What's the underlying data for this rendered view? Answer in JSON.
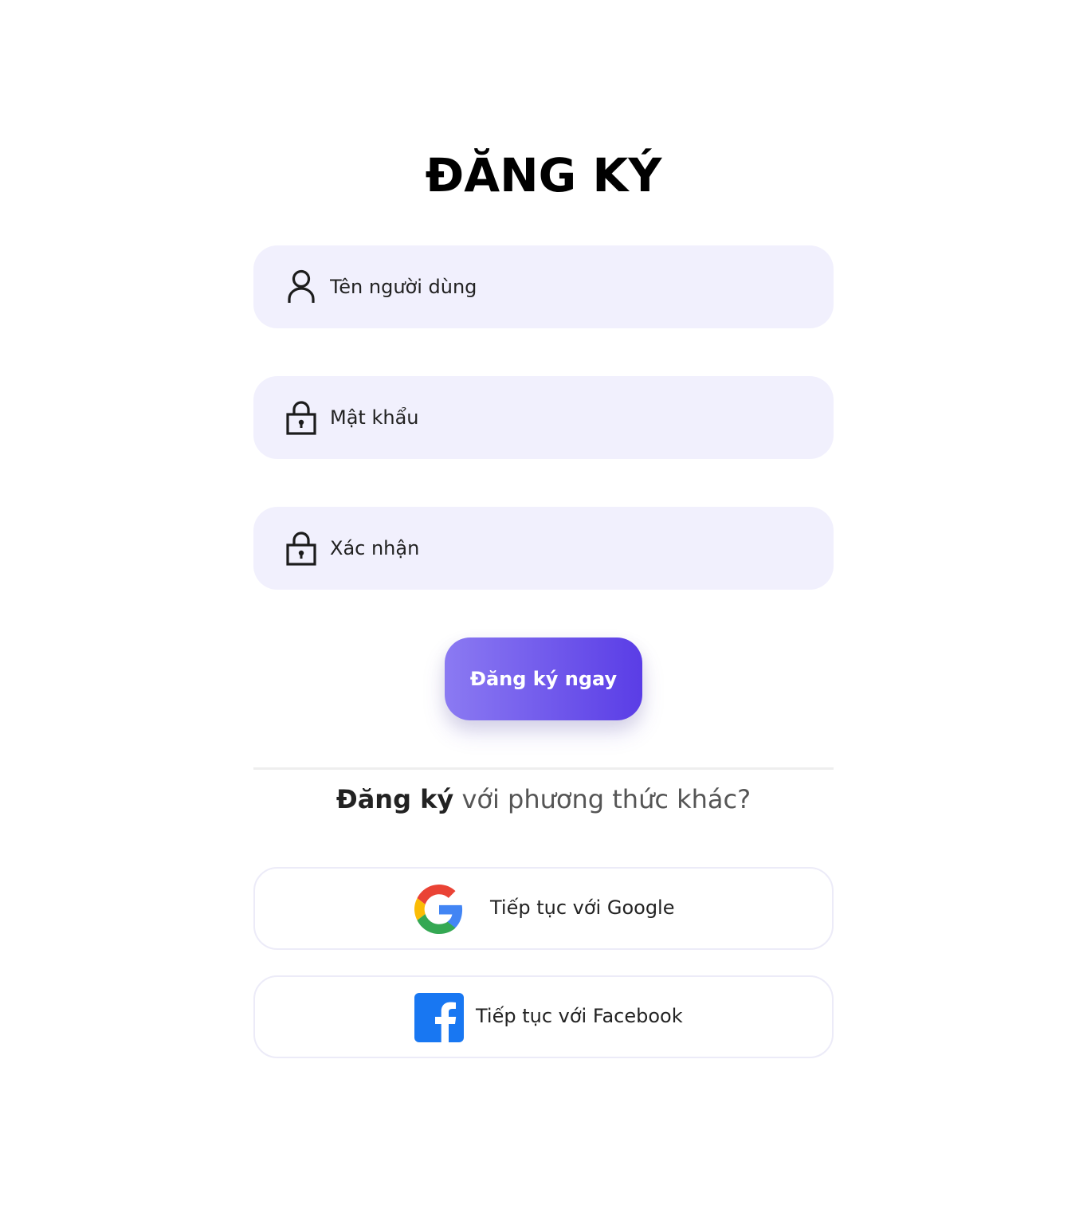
{
  "header": {
    "title": "ĐĂNG KÝ"
  },
  "form": {
    "username_placeholder": "Tên người dùng",
    "password_placeholder": "Mật khẩu",
    "confirm_placeholder": "Xác nhận",
    "submit_label": "Đăng ký ngay"
  },
  "alternative": {
    "prompt_strong": "Đăng ký",
    "prompt_rest": " với phương thức khác?",
    "google_label": "Tiếp tục với Google",
    "facebook_label": "Tiếp tục với Facebook"
  },
  "icons": {
    "username": "user-icon",
    "password": "lock-icon",
    "confirm": "lock-icon",
    "google": "google-logo-icon",
    "facebook": "facebook-logo-icon"
  },
  "colors": {
    "field_bg": "#f1f0fd",
    "button_gradient_start": "#8b7af2",
    "button_gradient_end": "#5a3de6",
    "facebook_blue": "#1877f2"
  }
}
